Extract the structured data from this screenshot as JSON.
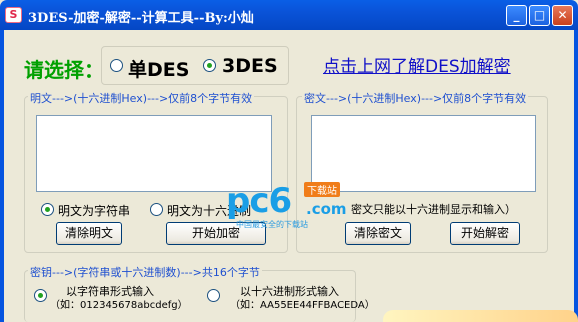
{
  "window": {
    "title": "3DES-加密-解密--计算工具--By:小灿",
    "app_icon": "S",
    "minimize": "_",
    "maximize": "□",
    "close": "✕"
  },
  "mode": {
    "prompt": "请选择：",
    "options": [
      {
        "label": "单DES",
        "selected": false
      },
      {
        "label": "3DES",
        "selected": true
      }
    ]
  },
  "help_link": "点击上网了解DES加解密",
  "plaintext": {
    "group_label": "明文--->(十六进制Hex)--->仅前8个字节有效",
    "value": "",
    "opt_string": "明文为字符串",
    "opt_hex": "明文为十六进制",
    "clear_button": "清除明文",
    "encrypt_button": "开始加密"
  },
  "ciphertext": {
    "group_label": "密文--->(十六进制Hex)--->仅前8个字节有效",
    "value": "",
    "note": "密文只能以十六进制显示和输入）",
    "clear_button": "清除密文",
    "decrypt_button": "开始解密"
  },
  "key": {
    "group_label": "密钥--->(字符串或十六进制数)--->共16个字节",
    "opt_string": "以字符串形式输入",
    "opt_string_example": "（如：012345678abcdefg）",
    "opt_hex": "以十六进制形式输入",
    "opt_hex_example": "（如：AA55EE44FFBACEDA）"
  },
  "watermark": {
    "logo": "pc6",
    "domain": ".com",
    "badge": "下载站",
    "tagline": "中国最安全的下载站"
  },
  "colors": {
    "titlebar": "#0a53d8",
    "prompt": "#00a000",
    "link": "#1010c8",
    "group_label": "#1f50d0"
  }
}
